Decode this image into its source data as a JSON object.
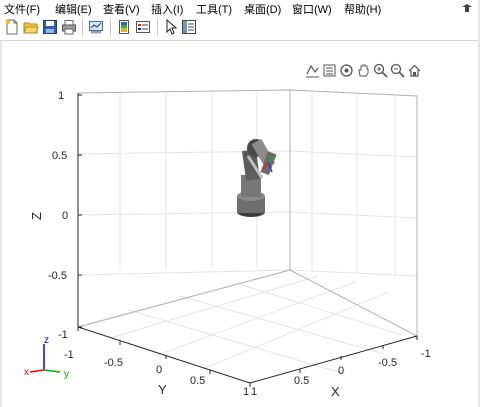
{
  "menu": [
    {
      "label": "文件(F)"
    },
    {
      "label": "编辑(E)"
    },
    {
      "label": "查看(V)"
    },
    {
      "label": "插入(I)"
    },
    {
      "label": "工具(T)"
    },
    {
      "label": "桌面(D)"
    },
    {
      "label": "窗口(W)"
    },
    {
      "label": "帮助(H)"
    }
  ],
  "toolbar": [
    "new-figure-icon",
    "open-file-icon",
    "save-icon",
    "print-icon",
    "link-plot-icon",
    "colorbar-icon",
    "legend-icon",
    "select-pointer-icon",
    "property-inspector-icon"
  ],
  "axes_toolbar": [
    "data-tips-icon",
    "brush-icon",
    "rotate-3d-icon",
    "pan-icon",
    "zoom-in-icon",
    "zoom-out-icon",
    "home-icon"
  ],
  "chart_data": {
    "type": "3d-plot",
    "xlabel": "X",
    "ylabel": "Y",
    "zlabel": "Z",
    "xlim": [
      -1,
      1
    ],
    "ylim": [
      -1,
      1
    ],
    "zlim": [
      -1,
      1
    ],
    "x_ticks": [
      "1",
      "0.5",
      "0",
      "-0.5",
      "-1"
    ],
    "y_ticks": [
      "-1",
      "-0.5",
      "0",
      "0.5",
      "1"
    ],
    "z_ticks": [
      "1",
      "0.5",
      "0",
      "-0.5",
      "-1"
    ],
    "grid": true,
    "object": "robot-arm-model",
    "triad_labels": [
      "x",
      "y",
      "z"
    ],
    "colors": {
      "x": "#ff0000",
      "y": "#00b000",
      "z": "#0000ff",
      "robot": "#6e6e6e",
      "grid": "#e3e3e3",
      "axis": "#262626"
    }
  }
}
